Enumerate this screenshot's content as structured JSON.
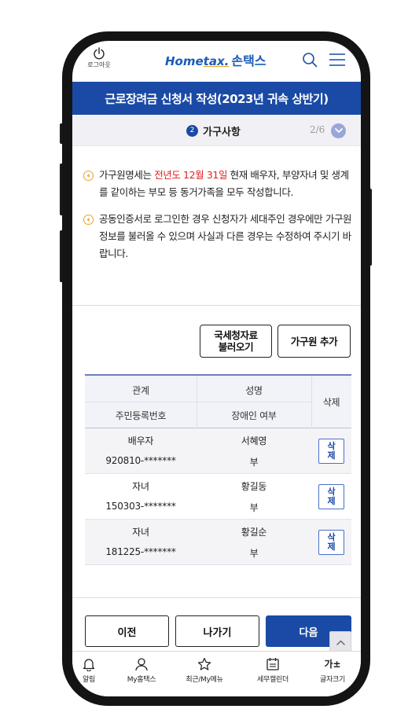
{
  "header": {
    "logout_label": "로그아웃",
    "logo_home": "Home",
    "logo_tax": "tax.",
    "logo_son": "손택스"
  },
  "page_title": "근로장려금 신청서 작성(2023년 귀속 상반기)",
  "step": {
    "number": "2",
    "name": "가구사항",
    "progress": "2/6"
  },
  "notices": [
    {
      "pre": "가구원명세는 ",
      "highlight": "전년도 12월 31일",
      "post": " 현재 배우자, 부양자녀 및 생계를 같이하는 부모 등 동거가족을 모두 작성합니다."
    },
    {
      "pre": "공동인증서로 로그인한 경우 신청자가 세대주인 경우에만 가구원정보를 불러올 수 있으며 사실과 다른 경우는 수정하여 주시기 바랍니다.",
      "highlight": "",
      "post": ""
    }
  ],
  "actions": {
    "nts_line1": "국세청자료",
    "nts_line2": "불러오기",
    "add_member": "가구원 추가"
  },
  "table": {
    "headers": {
      "relation": "관계",
      "name": "성명",
      "reg_no": "주민등록번호",
      "disability": "장애인 여부",
      "delete": "삭제"
    },
    "rows": [
      {
        "relation": "배우자",
        "name": "서혜영",
        "reg_no": "920810-*******",
        "disability": "부",
        "del_1": "삭",
        "del_2": "제"
      },
      {
        "relation": "자녀",
        "name": "황길동",
        "reg_no": "150303-*******",
        "disability": "부",
        "del_1": "삭",
        "del_2": "제"
      },
      {
        "relation": "자녀",
        "name": "황길순",
        "reg_no": "181225-*******",
        "disability": "부",
        "del_1": "삭",
        "del_2": "제"
      }
    ]
  },
  "nav": {
    "prev": "이전",
    "exit": "나가기",
    "next": "다음"
  },
  "tabbar": {
    "alert": "알림",
    "my": "My홈택스",
    "recent": "최근/My메뉴",
    "calendar": "세무캘린더",
    "font_glyph": "가±",
    "font": "글자크기"
  },
  "colors": {
    "primary": "#1a4aa5",
    "highlight": "#e02020",
    "bullet": "#e8a22a"
  }
}
